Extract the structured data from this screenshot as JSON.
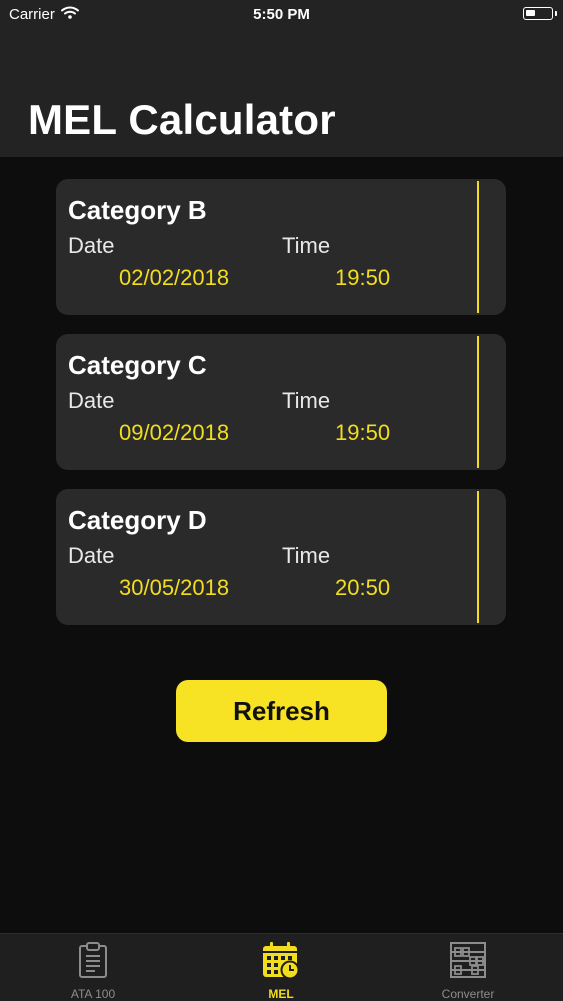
{
  "status_bar": {
    "carrier": "Carrier",
    "time": "5:50 PM"
  },
  "header": {
    "title": "MEL Calculator"
  },
  "cards": [
    {
      "title": "Category B",
      "date_label": "Date",
      "time_label": "Time",
      "date": "02/02/2018",
      "time": "19:50"
    },
    {
      "title": "Category C",
      "date_label": "Date",
      "time_label": "Time",
      "date": "09/02/2018",
      "time": "19:50"
    },
    {
      "title": "Category D",
      "date_label": "Date",
      "time_label": "Time",
      "date": "30/05/2018",
      "time": "20:50"
    }
  ],
  "refresh_label": "Refresh",
  "tabs": [
    {
      "label": "ATA 100",
      "icon": "clipboard-icon",
      "active": false
    },
    {
      "label": "MEL",
      "icon": "calendar-clock-icon",
      "active": true
    },
    {
      "label": "Converter",
      "icon": "abacus-icon",
      "active": false
    }
  ],
  "colors": {
    "accent": "#f2dd1f",
    "background": "#0d0d0e",
    "card": "#2a2a2b",
    "header": "#232324"
  }
}
